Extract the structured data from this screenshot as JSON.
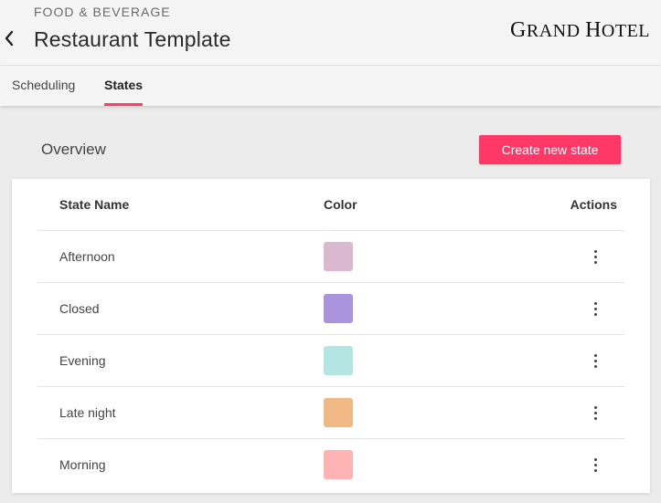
{
  "header": {
    "category": "FOOD & BEVERAGE",
    "title": "Restaurant Template",
    "logo_text": "GRAND HOTEL",
    "back_icon": "chevron-left-icon"
  },
  "tabs": [
    {
      "label": "Scheduling",
      "active": false
    },
    {
      "label": "States",
      "active": true
    }
  ],
  "overview": {
    "title": "Overview",
    "create_button": "Create new state"
  },
  "table": {
    "columns": [
      "State Name",
      "Color",
      "Actions"
    ],
    "rows": [
      {
        "name": "Afternoon",
        "color": "#dab8cf"
      },
      {
        "name": "Closed",
        "color": "#a994dd"
      },
      {
        "name": "Evening",
        "color": "#b3e6e2"
      },
      {
        "name": "Late night",
        "color": "#efb885"
      },
      {
        "name": "Morning",
        "color": "#ffb3b3"
      }
    ],
    "action_icon": "more-vertical-icon"
  },
  "colors": {
    "accent": "#ff3868",
    "background": "#ececec",
    "header_background": "#f5f5f5"
  }
}
